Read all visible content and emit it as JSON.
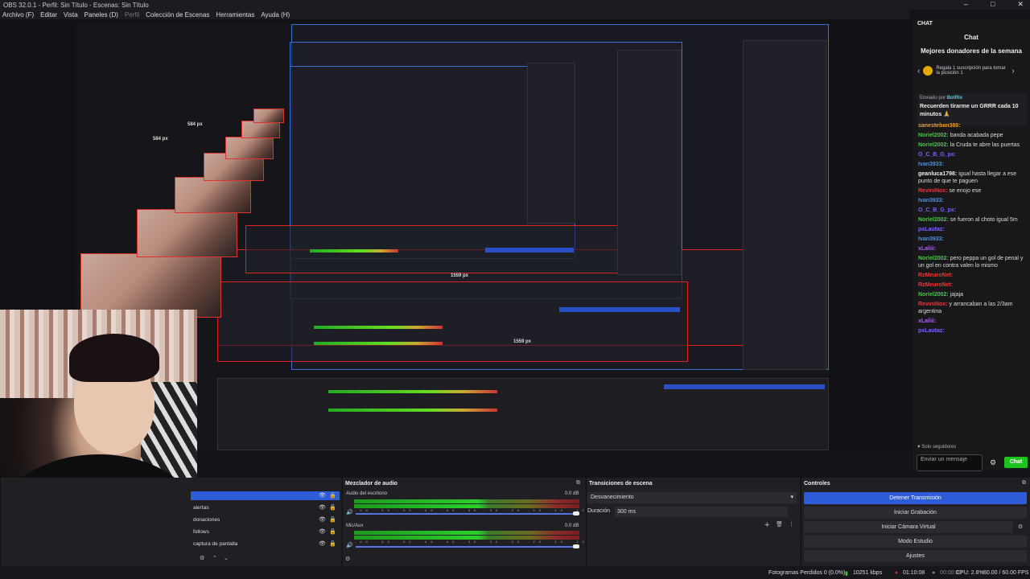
{
  "window": {
    "title": "OBS 32.0.1 - Perfil: Sin Título - Escenas: Sin Título",
    "controls": [
      "–",
      "□",
      "✕"
    ]
  },
  "menu": [
    {
      "label": "Archivo (F)",
      "dim": false
    },
    {
      "label": "Editar",
      "dim": false
    },
    {
      "label": "Vista",
      "dim": false
    },
    {
      "label": "Paneles (D)",
      "dim": false
    },
    {
      "label": "Perfil",
      "dim": true
    },
    {
      "label": "Colección de Escenas",
      "dim": false
    },
    {
      "label": "Herramientas",
      "dim": false
    },
    {
      "label": "Ayuda (H)",
      "dim": false
    }
  ],
  "preview": {
    "labels": {
      "px584": "584 px",
      "px1559": "1559 px"
    }
  },
  "chat": {
    "header": "CHAT",
    "title": "Chat",
    "donors_title": "Mejores donadores de la semana",
    "donor_text": "Regala 1 suscripción para tomar la posición 1",
    "pinned": {
      "sent_by_prefix": "Enviado por",
      "sent_by_user": "BotRix",
      "message": "Recuerden tirarme un GRRR cada 10 minutos 🙏"
    },
    "messages": [
      {
        "user": "sanesteban388:",
        "text": "",
        "color": "#e0a030"
      },
      {
        "user": "Noriel2002:",
        "text": "banda acabada pepe",
        "color": "#3bd13b"
      },
      {
        "user": "Noriel2002:",
        "text": "la Cruda te abre las puertas",
        "color": "#3bd13b"
      },
      {
        "user": "O_C_B_G_px:",
        "text": "",
        "color": "#7b61ff"
      },
      {
        "user": "Ivan3933:",
        "text": "",
        "color": "#4a90e2"
      },
      {
        "user": "geanluca1798:",
        "text": "igual hasta llegar a ese punto de que te paguen",
        "color": "#eeeeee"
      },
      {
        "user": "ReviniNox:",
        "text": "se enojo ese",
        "color": "#e23b3b"
      },
      {
        "user": "Ivan3933:",
        "text": "",
        "color": "#4a90e2"
      },
      {
        "user": "O_C_B_G_px:",
        "text": "",
        "color": "#7b61ff"
      },
      {
        "user": "Noriel2002:",
        "text": "se fueron al choto igual 5m",
        "color": "#3bd13b"
      },
      {
        "user": "pxLautaz:",
        "text": "",
        "color": "#7b61ff"
      },
      {
        "user": "Ivan3933:",
        "text": "",
        "color": "#4a90e2"
      },
      {
        "user": "xLaliii:",
        "text": "",
        "color": "#b05cff"
      },
      {
        "user": "Noriel2002:",
        "text": "pero peppa un gol de penal y un gol en contra valen lo mismo",
        "color": "#3bd13b"
      },
      {
        "user": "RzMeuroNet:",
        "text": "",
        "color": "#e23b3b"
      },
      {
        "user": "RzMeuroNet:",
        "text": "",
        "color": "#e23b3b"
      },
      {
        "user": "Noriel2002:",
        "text": "jajaja",
        "color": "#3bd13b"
      },
      {
        "user": "ReviniNox:",
        "text": "y arrancaban a las 2/3am argentina",
        "color": "#e23b3b"
      },
      {
        "user": "xLaliii:",
        "text": "",
        "color": "#b05cff"
      },
      {
        "user": "pxLautaz:",
        "text": "",
        "color": "#7b61ff"
      }
    ],
    "followers_only": "Solo seguidores",
    "input_placeholder": "Enviar un mensaje",
    "send_label": "Chat"
  },
  "scenes": {
    "sources": [
      "alertas",
      "donaciones",
      "follows",
      "captura de pantalla"
    ]
  },
  "mixer": {
    "title": "Mezclador de audio",
    "channels": [
      {
        "name": "Audio del escritorio",
        "db": "0.0 dB",
        "level": 0.56,
        "volume": 1.0
      },
      {
        "name": "Mic/Aux",
        "db": "0.0 dB",
        "level": 0.62,
        "volume": 1.0
      }
    ],
    "ticks": "-60 -55 -50 -45 -40 -35 -30 -25 -20 -15 -10 -5 0"
  },
  "transitions": {
    "title": "Transiciones de escena",
    "selected": "Desvanecimiento",
    "duration_label": "Duración",
    "duration_value": "300 ms"
  },
  "controls": {
    "title": "Controles",
    "buttons": [
      "Detener Transmisión",
      "Iniciar Grabación",
      "Iniciar Cámara Virtual",
      "Modo Estudio",
      "Ajustes"
    ]
  },
  "status": {
    "dropped": "Fotogramas Perdidos 0 (0.0%)",
    "bitrate": "10251 kbps",
    "time1": "01:10:08",
    "time2": "00:00:00",
    "cpu": "CPU: 2.6%",
    "fps": "60.00 / 60.00 FPS"
  }
}
